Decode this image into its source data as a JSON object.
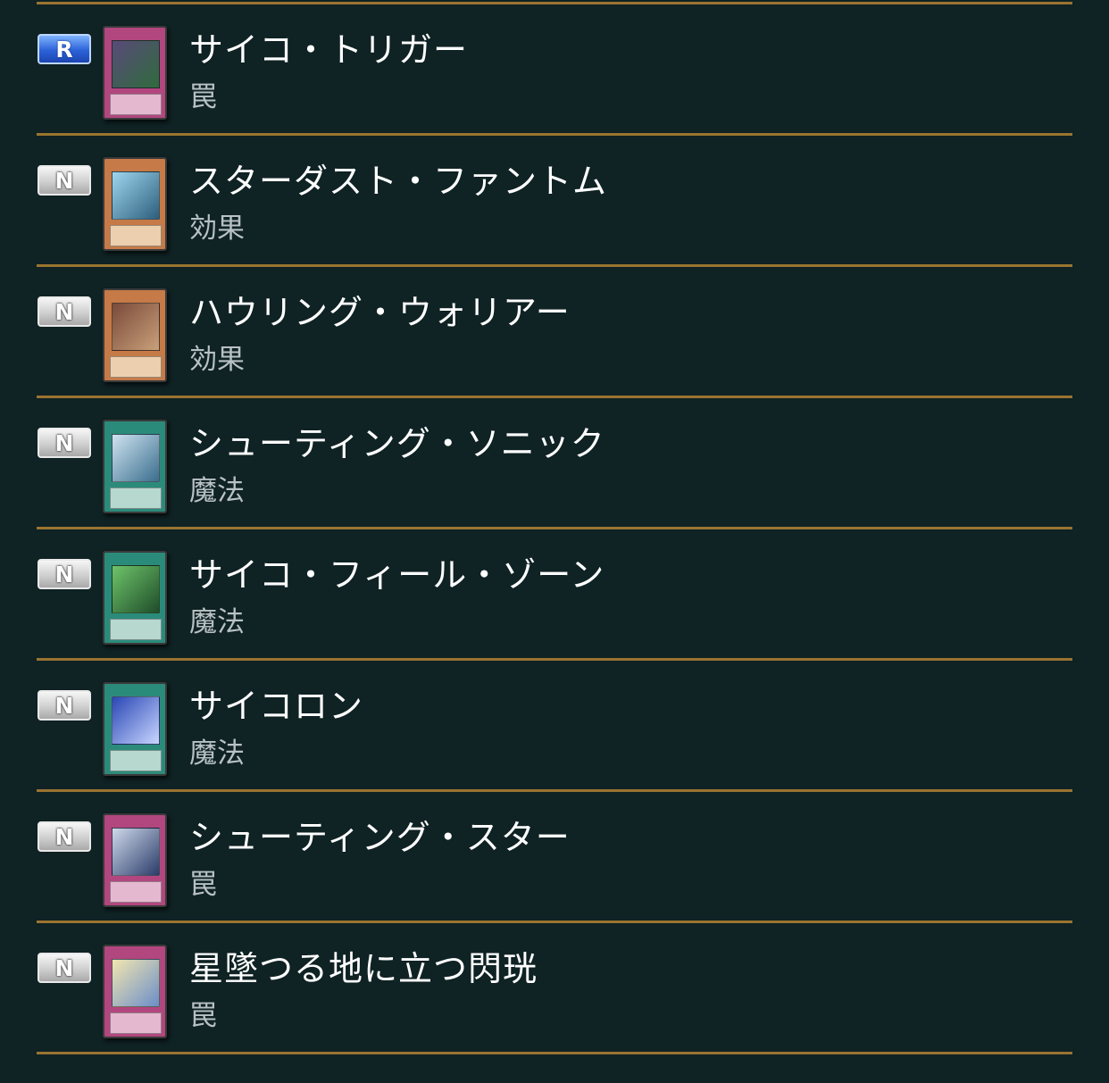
{
  "colors": {
    "background": "#0f2224",
    "separator": "#9a7431",
    "rarity_r": "#2c62d8",
    "rarity_n": "#cfcfcf",
    "trap_card": "#b2467f",
    "spell_card": "#2b8b7b",
    "effect_card": "#c57a48"
  },
  "cards": [
    {
      "rarity": "R",
      "name": "サイコ・トリガー",
      "type": "罠",
      "frame": "trap",
      "art_colors": [
        "#5a4a7a",
        "#2e6b3c"
      ]
    },
    {
      "rarity": "N",
      "name": "スターダスト・ファントム",
      "type": "効果",
      "frame": "effect",
      "art_colors": [
        "#9fd6ee",
        "#2d5f7c"
      ]
    },
    {
      "rarity": "N",
      "name": "ハウリング・ウォリアー",
      "type": "効果",
      "frame": "effect",
      "art_colors": [
        "#7a4a3a",
        "#c9a07a"
      ]
    },
    {
      "rarity": "N",
      "name": "シューティング・ソニック",
      "type": "魔法",
      "frame": "spell",
      "art_colors": [
        "#cfe3f0",
        "#3a6e8e"
      ]
    },
    {
      "rarity": "N",
      "name": "サイコ・フィール・ゾーン",
      "type": "魔法",
      "frame": "spell",
      "art_colors": [
        "#6ec46a",
        "#1f4d2a"
      ]
    },
    {
      "rarity": "N",
      "name": "サイコロン",
      "type": "魔法",
      "frame": "spell",
      "art_colors": [
        "#2a47b5",
        "#c9d6ff"
      ]
    },
    {
      "rarity": "N",
      "name": "シューティング・スター",
      "type": "罠",
      "frame": "trap",
      "art_colors": [
        "#cfd9ea",
        "#2a3c6a"
      ]
    },
    {
      "rarity": "N",
      "name": "星墜つる地に立つ閃珖",
      "type": "罠",
      "frame": "trap",
      "art_colors": [
        "#f2e6b0",
        "#6b8ec9"
      ]
    }
  ]
}
